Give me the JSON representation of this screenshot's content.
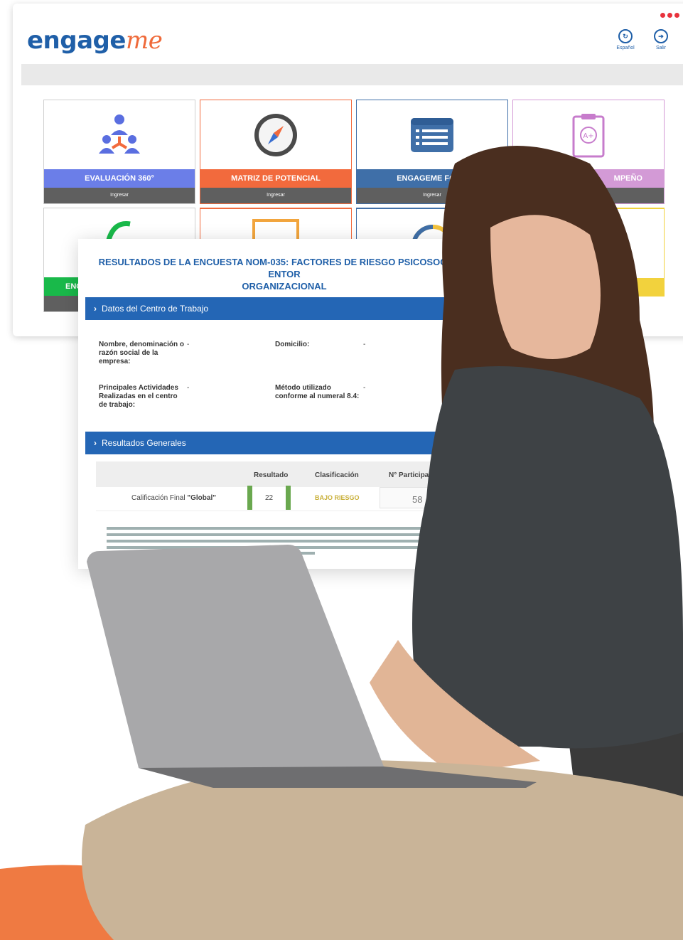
{
  "app": {
    "logo_main": "engage",
    "logo_accent": "me",
    "header_actions": [
      {
        "icon": "language-icon",
        "label": "Español"
      },
      {
        "icon": "logout-icon",
        "label": "Salir"
      }
    ]
  },
  "tiles": [
    {
      "label": "EVALUACIÓN 360°",
      "link": "Ingresar",
      "color": "#6b7ee8",
      "icon": "team-hierarchy-icon"
    },
    {
      "label": "MATRIZ DE POTENCIAL",
      "link": "Ingresar",
      "color": "#f26a3d",
      "icon": "compass-icon"
    },
    {
      "label": "ENGAGEME FORM",
      "link": "Ingresar",
      "color": "#3f6fa8",
      "icon": "form-list-icon"
    },
    {
      "label": "MPEÑO",
      "link": "",
      "color": "#d39ad6",
      "icon": "clipboard-grade-icon"
    }
  ],
  "second_row": [
    {
      "label": "ENC",
      "color": "#19b94a"
    }
  ],
  "report": {
    "title_line1": "RESULTADOS DE LA ENCUESTA NOM-035: FACTORES DE RIESGO PSICOSOCIAL Y ENTOR",
    "title_line2": "ORGANIZACIONAL",
    "section1": "Datos del Centro de Trabajo",
    "fields": {
      "company_label": "Nombre, denominación o razón social de la empresa:",
      "company_value": "-",
      "address_label": "Domicilio:",
      "address_value": "-",
      "activities_label": "Principales Actividades Realizadas en el centro de trabajo:",
      "activities_value": "-",
      "method_label": "Método utilizado conforme al numeral 8.4:",
      "method_value": "-"
    },
    "section2": "Resultados Generales",
    "table": {
      "headers": [
        "Resultado",
        "Clasificación",
        "N° Participante"
      ],
      "row_label_prefix": "Calificación Final ",
      "row_label_bold": "\"Global\"",
      "result": "22",
      "classification": "BAJO RIESGO",
      "participants": "58"
    },
    "colors": {
      "header_blue": "#2466b5",
      "risk_low": "#c9b03a",
      "bar_green": "#6aa84f"
    }
  }
}
